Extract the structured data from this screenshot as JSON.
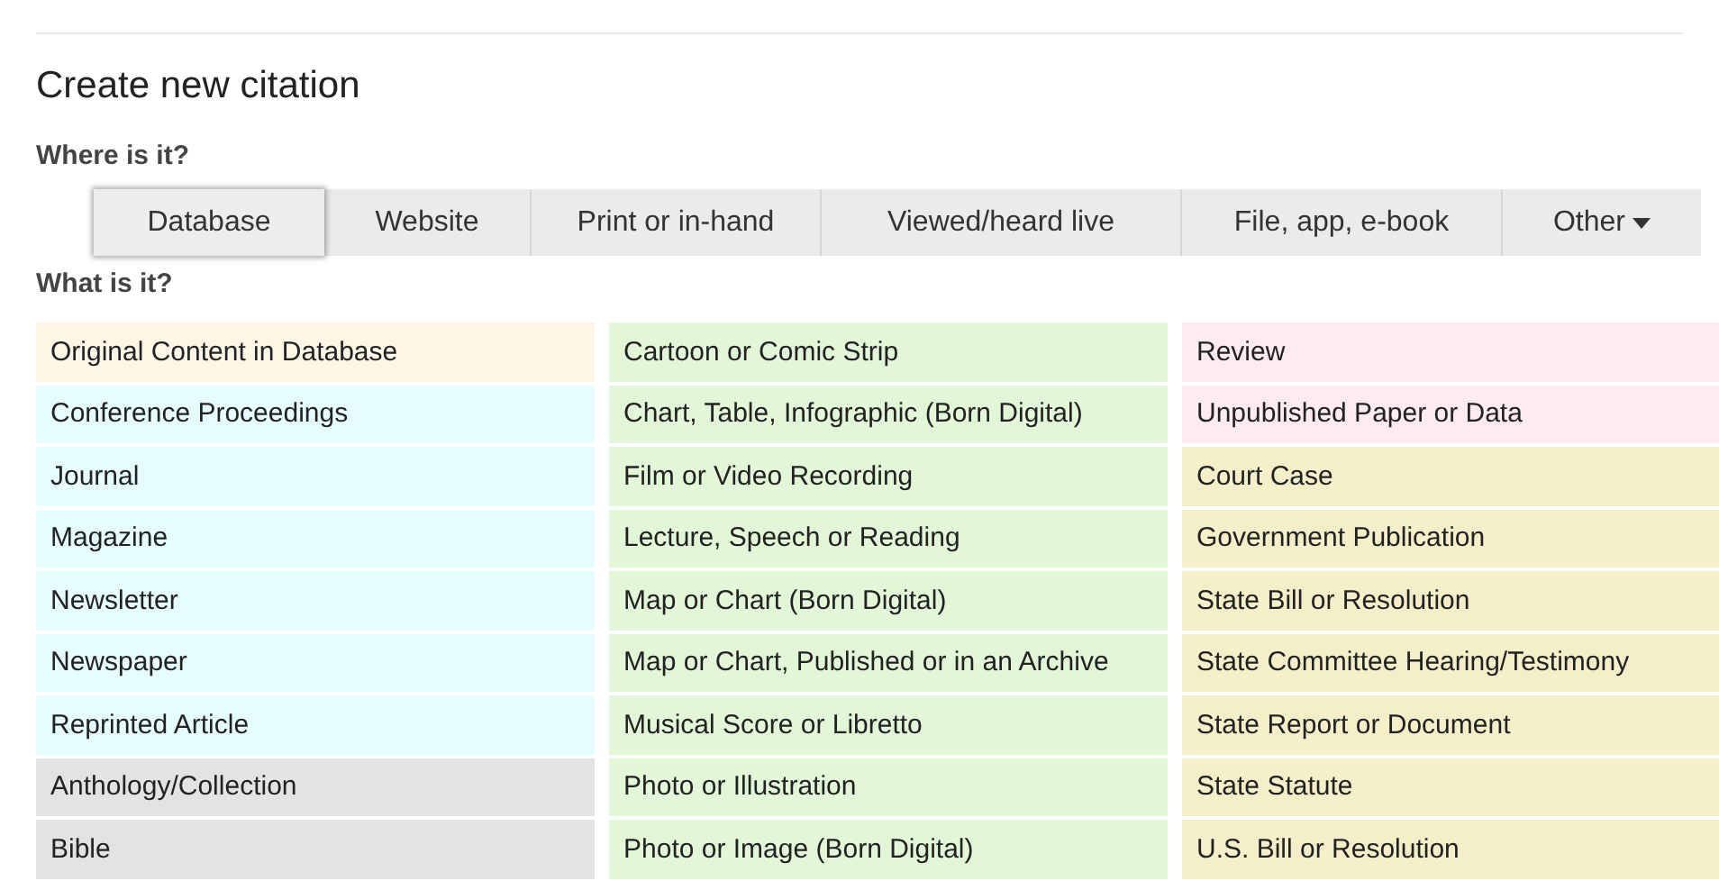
{
  "title": "Create new citation",
  "where": {
    "label": "Where is it?",
    "tabs": [
      {
        "label": "Database",
        "selected": true
      },
      {
        "label": "Website",
        "selected": false
      },
      {
        "label": "Print or in-hand",
        "selected": false
      },
      {
        "label": "Viewed/heard live",
        "selected": false
      },
      {
        "label": "File, app, e-book",
        "selected": false
      },
      {
        "label": "Other",
        "selected": false,
        "kind": "dropdown"
      }
    ]
  },
  "what": {
    "label": "What is it?",
    "columns": [
      [
        {
          "label": "Original Content in Database",
          "color": "#fdf5e6"
        },
        {
          "label": "Conference Proceedings",
          "color": "#e6fdfd"
        },
        {
          "label": "Journal",
          "color": "#e6fdfd"
        },
        {
          "label": "Magazine",
          "color": "#e6fdfd"
        },
        {
          "label": "Newsletter",
          "color": "#e6fdfd"
        },
        {
          "label": "Newspaper",
          "color": "#e6fdfd"
        },
        {
          "label": "Reprinted Article",
          "color": "#e6fdfd"
        },
        {
          "label": "Anthology/Collection",
          "color": "#e3e3e3"
        },
        {
          "label": "Bible",
          "color": "#e3e3e3"
        }
      ],
      [
        {
          "label": "Cartoon or Comic Strip",
          "color": "#e2f6d8"
        },
        {
          "label": "Chart, Table, Infographic (Born Digital)",
          "color": "#e2f6d8"
        },
        {
          "label": "Film or Video Recording",
          "color": "#e2f6d8"
        },
        {
          "label": "Lecture, Speech or Reading",
          "color": "#e2f6d8"
        },
        {
          "label": "Map or Chart (Born Digital)",
          "color": "#e2f6d8"
        },
        {
          "label": "Map or Chart, Published or in an Archive",
          "color": "#e2f6d8"
        },
        {
          "label": "Musical Score or Libretto",
          "color": "#e2f6d8"
        },
        {
          "label": "Photo or Illustration",
          "color": "#e2f6d8"
        },
        {
          "label": "Photo or Image (Born Digital)",
          "color": "#e2f6d8"
        }
      ],
      [
        {
          "label": "Review",
          "color": "#fdeaf3"
        },
        {
          "label": "Unpublished Paper or Data",
          "color": "#fdeaf3"
        },
        {
          "label": "Court Case",
          "color": "#f4eec9"
        },
        {
          "label": "Government Publication",
          "color": "#f4eec9"
        },
        {
          "label": "State Bill or Resolution",
          "color": "#f4eec9"
        },
        {
          "label": "State Committee Hearing/Testimony",
          "color": "#f4eec9"
        },
        {
          "label": "State Report or Document",
          "color": "#f4eec9"
        },
        {
          "label": "State Statute",
          "color": "#f4eec9"
        },
        {
          "label": "U.S. Bill or Resolution",
          "color": "#f4eec9"
        }
      ]
    ]
  }
}
